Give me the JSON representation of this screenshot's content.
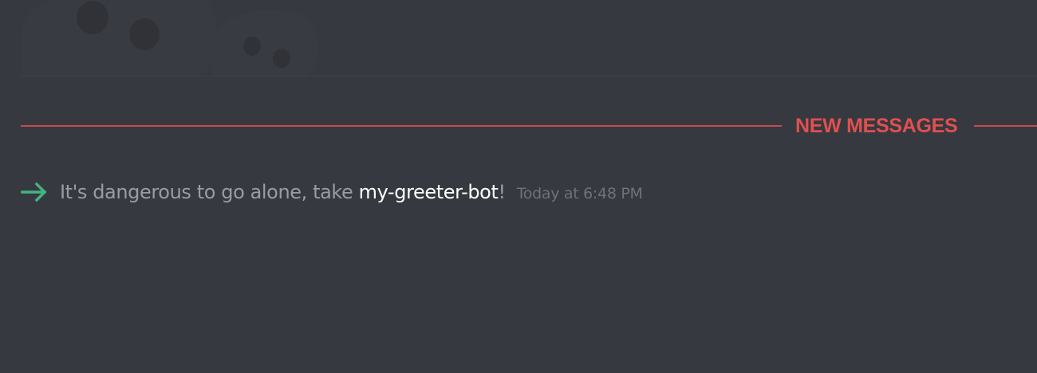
{
  "divider": {
    "label": "NEW MESSAGES",
    "color": "#e0504f"
  },
  "system_message": {
    "icon": "join-arrow-icon",
    "icon_color": "#43b581",
    "text_before": "It's dangerous to go alone, take ",
    "username": "my-greeter-bot",
    "text_after": "!",
    "timestamp": "Today at 6:48 PM"
  },
  "theme": {
    "background": "#36393f"
  }
}
